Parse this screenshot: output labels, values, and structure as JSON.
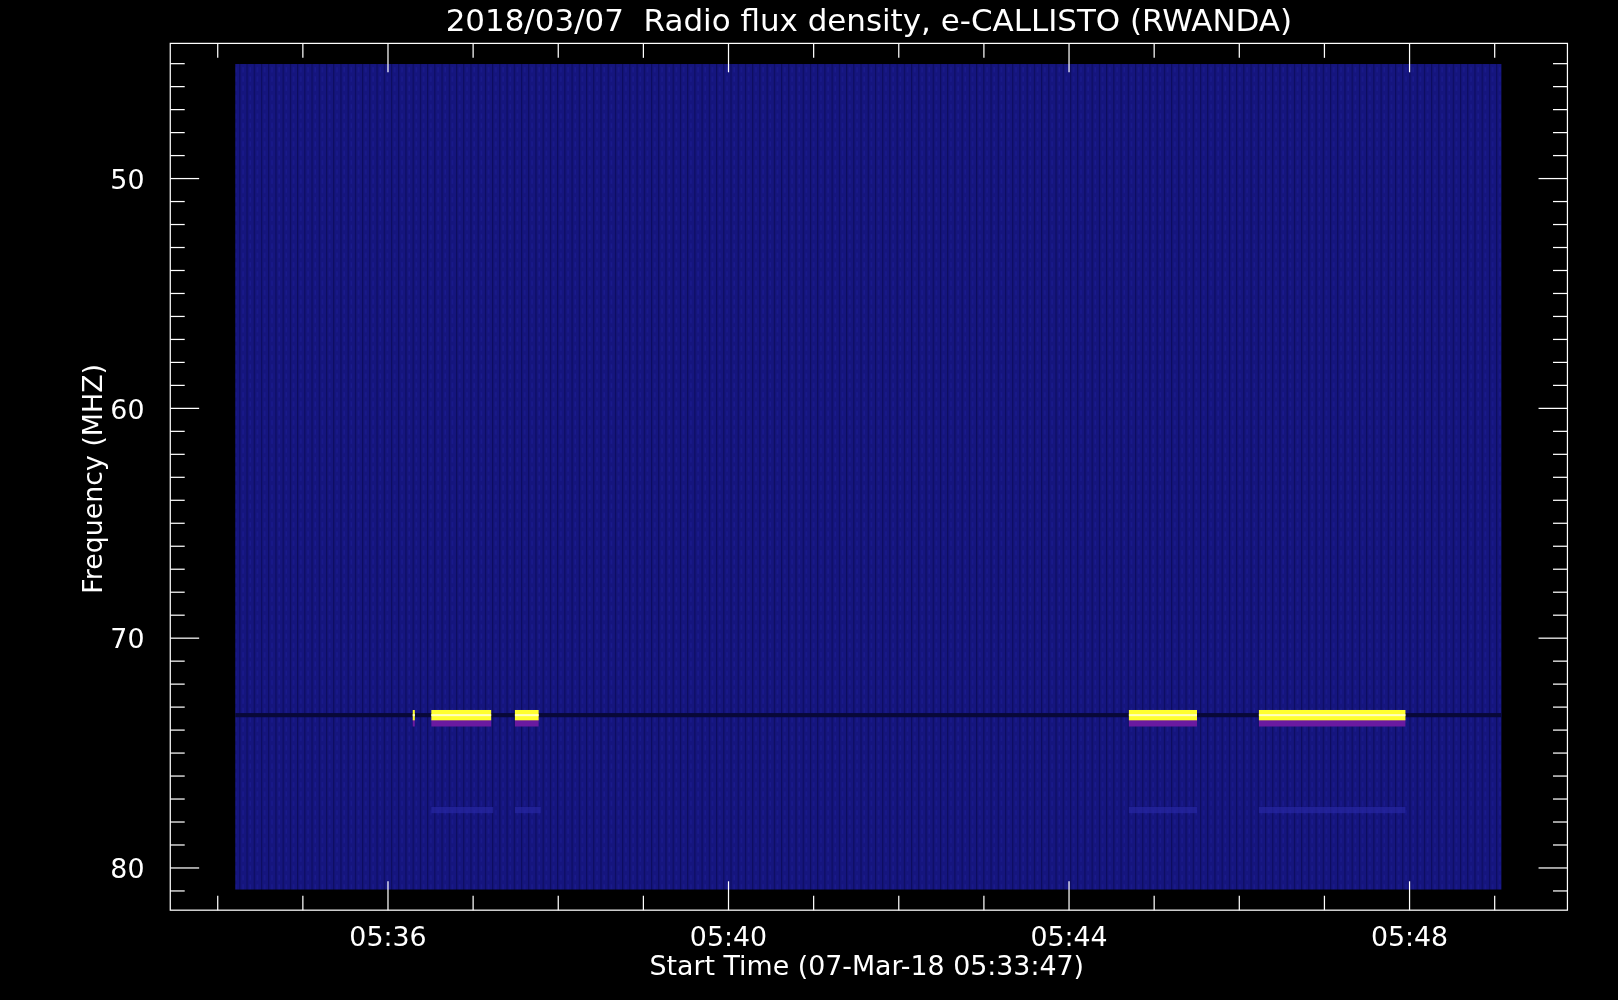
{
  "title": "2018/03/07  Radio flux density, e-CALLISTO (RWANDA)",
  "xlabel": "Start Time (07-Mar-18 05:33:47)",
  "ylabel": "Frequency (MHZ)",
  "xticks": [
    "05:36",
    "05:40",
    "05:44",
    "05:48"
  ],
  "yticks": [
    "50",
    "60",
    "70",
    "80"
  ]
}
